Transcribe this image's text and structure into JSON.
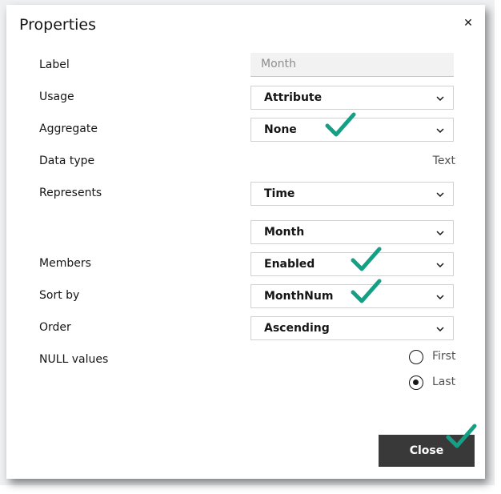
{
  "dialog": {
    "title": "Properties",
    "close_icon": "close-icon",
    "close_button_label": "Close"
  },
  "fields": {
    "label": {
      "label": "Label",
      "placeholder": "Month"
    },
    "usage": {
      "label": "Usage",
      "value": "Attribute"
    },
    "aggregate": {
      "label": "Aggregate",
      "value": "None"
    },
    "data_type": {
      "label": "Data type",
      "value": "Text"
    },
    "represents": {
      "label": "Represents",
      "value": "Time",
      "sub_value": "Month"
    },
    "members": {
      "label": "Members",
      "value": "Enabled"
    },
    "sort_by": {
      "label": "Sort by",
      "value": "MonthNum"
    },
    "order": {
      "label": "Order",
      "value": "Ascending"
    },
    "null_values": {
      "label": "NULL values",
      "options": [
        "First",
        "Last"
      ],
      "selected": "Last"
    }
  },
  "colors": {
    "checkmark": "#14a085",
    "button_bg": "#393939"
  }
}
